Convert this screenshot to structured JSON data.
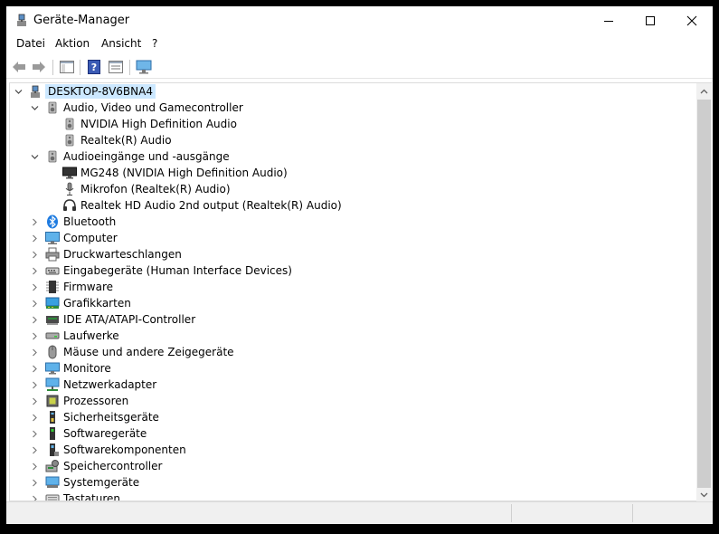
{
  "window": {
    "title": "Geräte-Manager"
  },
  "menu": [
    {
      "label": "Datei"
    },
    {
      "label": "Aktion"
    },
    {
      "label": "Ansicht"
    },
    {
      "label": "?"
    }
  ],
  "tree": {
    "root": "DESKTOP-8V6BNA4",
    "rows": [
      {
        "label": "Audio, Video und Gamecontroller",
        "level": 1,
        "expanded": true,
        "icon": "speaker-icon"
      },
      {
        "label": "NVIDIA High Definition Audio",
        "level": 2,
        "icon": "speaker-icon"
      },
      {
        "label": "Realtek(R) Audio",
        "level": 2,
        "icon": "speaker-icon"
      },
      {
        "label": "Audioeingänge und -ausgänge",
        "level": 1,
        "expanded": true,
        "icon": "speaker-icon"
      },
      {
        "label": "MG248 (NVIDIA High Definition Audio)",
        "level": 2,
        "icon": "monitor-dark-icon"
      },
      {
        "label": "Mikrofon (Realtek(R) Audio)",
        "level": 2,
        "icon": "microphone-icon"
      },
      {
        "label": "Realtek HD Audio 2nd output (Realtek(R) Audio)",
        "level": 2,
        "icon": "headphones-icon"
      },
      {
        "label": "Bluetooth",
        "level": 1,
        "expanded": false,
        "icon": "bluetooth-icon"
      },
      {
        "label": "Computer",
        "level": 1,
        "expanded": false,
        "icon": "computer-icon"
      },
      {
        "label": "Druckwarteschlangen",
        "level": 1,
        "expanded": false,
        "icon": "printer-icon"
      },
      {
        "label": "Eingabegeräte (Human Interface Devices)",
        "level": 1,
        "expanded": false,
        "icon": "hid-icon"
      },
      {
        "label": "Firmware",
        "level": 1,
        "expanded": false,
        "icon": "firmware-icon"
      },
      {
        "label": "Grafikkarten",
        "level": 1,
        "expanded": false,
        "icon": "display-adapter-icon"
      },
      {
        "label": "IDE ATA/ATAPI-Controller",
        "level": 1,
        "expanded": false,
        "icon": "ide-controller-icon"
      },
      {
        "label": "Laufwerke",
        "level": 1,
        "expanded": false,
        "icon": "disk-drive-icon"
      },
      {
        "label": "Mäuse und andere Zeigegeräte",
        "level": 1,
        "expanded": false,
        "icon": "mouse-icon"
      },
      {
        "label": "Monitore",
        "level": 1,
        "expanded": false,
        "icon": "monitor-icon"
      },
      {
        "label": "Netzwerkadapter",
        "level": 1,
        "expanded": false,
        "icon": "network-adapter-icon"
      },
      {
        "label": "Prozessoren",
        "level": 1,
        "expanded": false,
        "icon": "processor-icon"
      },
      {
        "label": "Sicherheitsgeräte",
        "level": 1,
        "expanded": false,
        "icon": "security-device-icon"
      },
      {
        "label": "Softwaregeräte",
        "level": 1,
        "expanded": false,
        "icon": "software-device-icon"
      },
      {
        "label": "Softwarekomponenten",
        "level": 1,
        "expanded": false,
        "icon": "software-component-icon"
      },
      {
        "label": "Speichercontroller",
        "level": 1,
        "expanded": false,
        "icon": "storage-controller-icon"
      },
      {
        "label": "Systemgeräte",
        "level": 1,
        "expanded": false,
        "icon": "system-device-icon"
      },
      {
        "label": "Tastaturen",
        "level": 1,
        "expanded": false,
        "icon": "keyboard-icon"
      }
    ]
  }
}
